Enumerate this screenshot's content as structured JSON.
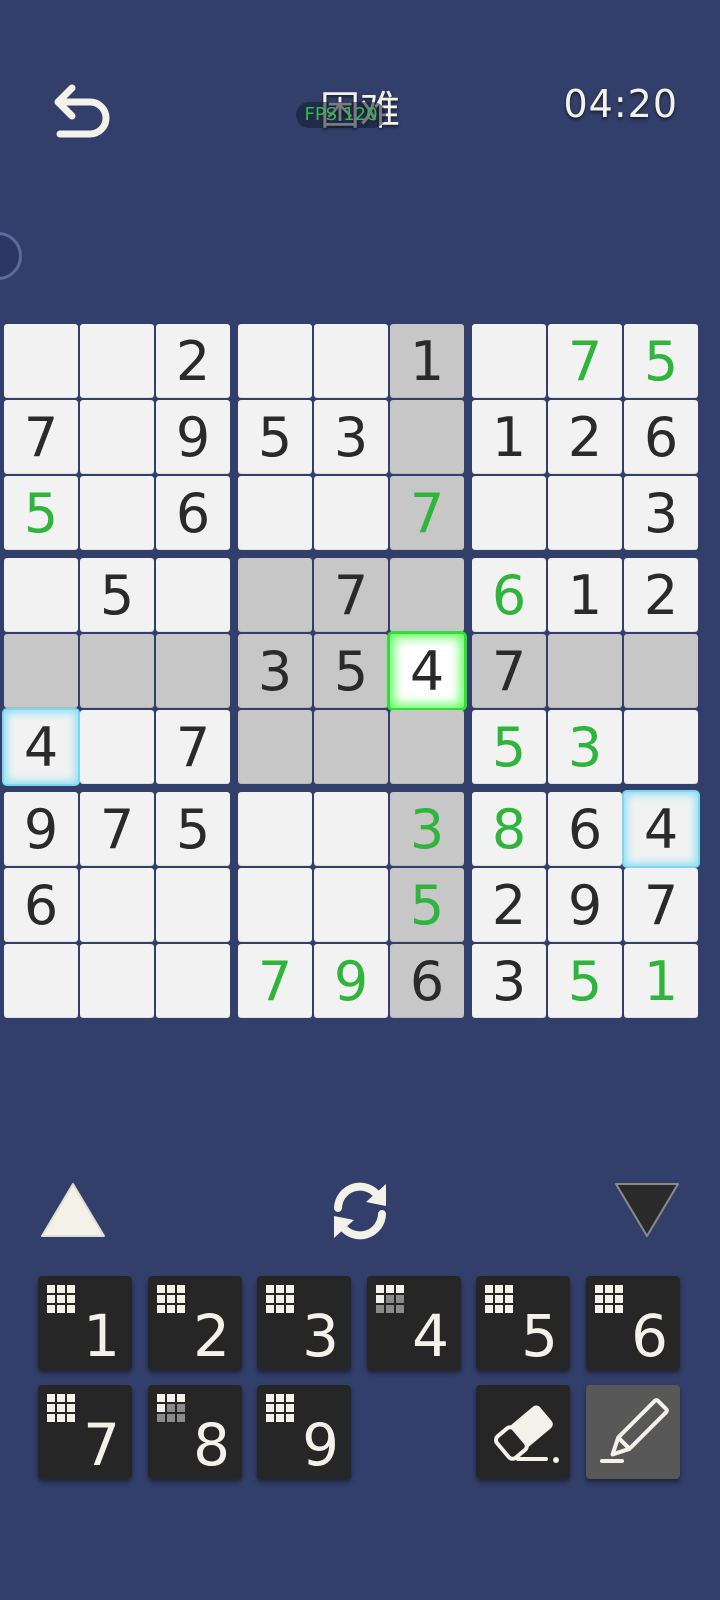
{
  "header": {
    "title": "困难",
    "timer": "04:20",
    "fps": "FPS:120"
  },
  "colors": {
    "background": "#323f6b",
    "cell": "#f2f2f2",
    "cell_highlight": "#c7c7c7",
    "given_digit": "#2a2a2a",
    "entered_digit": "#2fb43c",
    "selected_glow": "#33dd33",
    "match_glow": "#7fd6ec",
    "key_bg": "#262626"
  },
  "board": {
    "rows": [
      [
        "",
        "",
        "2",
        "",
        "",
        "1",
        "",
        "7",
        "5"
      ],
      [
        "7",
        "",
        "9",
        "5",
        "3",
        "",
        "1",
        "2",
        "6"
      ],
      [
        "5",
        "",
        "6",
        "",
        "",
        "7",
        "",
        "",
        "3"
      ],
      [
        "",
        "5",
        "",
        "",
        "7",
        "",
        "6",
        "1",
        "2"
      ],
      [
        "",
        "",
        "",
        "3",
        "5",
        "4",
        "7",
        "",
        ""
      ],
      [
        "4",
        "",
        "7",
        "",
        "",
        "",
        "5",
        "3",
        ""
      ],
      [
        "9",
        "7",
        "5",
        "",
        "",
        "3",
        "8",
        "6",
        "4"
      ],
      [
        "6",
        "",
        "",
        "",
        "",
        "5",
        "2",
        "9",
        "7"
      ],
      [
        "",
        "",
        "",
        "7",
        "9",
        "6",
        "3",
        "5",
        "1"
      ]
    ],
    "entered": [
      [
        0,
        7
      ],
      [
        0,
        8
      ],
      [
        2,
        0
      ],
      [
        2,
        5
      ],
      [
        3,
        6
      ],
      [
        5,
        6
      ],
      [
        5,
        7
      ],
      [
        6,
        5
      ],
      [
        6,
        6
      ],
      [
        7,
        5
      ],
      [
        8,
        3
      ],
      [
        8,
        4
      ],
      [
        8,
        7
      ],
      [
        8,
        8
      ]
    ],
    "selected": [
      4,
      5
    ],
    "same_number": [
      [
        5,
        0
      ],
      [
        6,
        8
      ]
    ]
  },
  "controls": {
    "up_icon": "triangle-up-icon",
    "refresh_icon": "refresh-icon",
    "down_icon": "triangle-down-icon"
  },
  "keypad": {
    "keys": [
      "1",
      "2",
      "3",
      "4",
      "5",
      "6",
      "7",
      "8",
      "9"
    ],
    "eraser_icon": "eraser-icon",
    "pencil_icon": "pencil-icon"
  }
}
